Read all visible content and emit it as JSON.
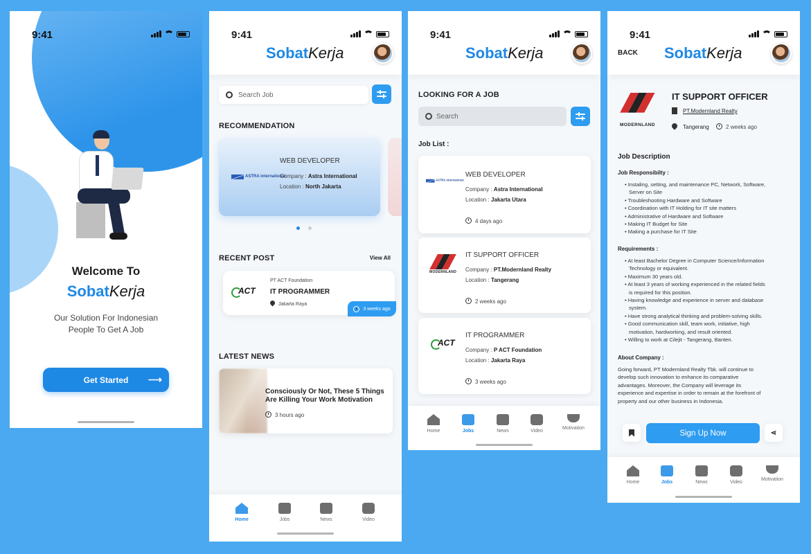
{
  "status": {
    "time": "9:41"
  },
  "brand": {
    "primary": "Sobat",
    "secondary": "Kerja"
  },
  "welcome": {
    "heading": "Welcome To",
    "tagline_line1": "Our Solution For Indonesian",
    "tagline_line2": "People To Get A Job",
    "cta": "Get Started",
    "arrow": "⟶"
  },
  "home": {
    "search_placeholder": "Search Job",
    "recommendation_title": "RECOMMENDATION",
    "rec_card": {
      "title": "WEB DEVELOPER",
      "company_label": "Company :",
      "company": "Astra International",
      "location_label": "Location :",
      "location": "North Jakarta",
      "logo_text": "ASTRA international"
    },
    "recent_post_title": "RECENT POST",
    "view_all": "View All",
    "recent_card": {
      "company": "PT ACT Foundation",
      "title": "IT PROGRAMMER",
      "location": "Jakarta Raya",
      "age": "3 weeks ago",
      "logo_text": "ACT"
    },
    "latest_news_title": "LATEST NEWS",
    "news": {
      "title_line1": "Consciously Or Not, These 5 Things",
      "title_line2": "Are Killing Your Work Motivation",
      "age": "3 hours ago"
    }
  },
  "jobs": {
    "heading": "LOOKING FOR A JOB",
    "search_placeholder": "Search",
    "list_title": "Job List :",
    "items": [
      {
        "title": "WEB DEVELOPER",
        "company_label": "Company :",
        "company": "Astra International",
        "location_label": "Location :",
        "location": "Jakarta Utara",
        "age": "4 days ago",
        "logo_text": "ASTRA international"
      },
      {
        "title": "IT SUPPORT OFFICER",
        "company_label": "Company :",
        "company": "PT.Modernland Realty",
        "location_label": "Location :",
        "location": "Tangerang",
        "age": "2 weeks ago",
        "logo_text": "MODERNLAND"
      },
      {
        "title": "IT PROGRAMMER",
        "company_label": "Company :",
        "company": "P ACT Foundation",
        "location_label": "Location :",
        "location": "Jakarta Raya",
        "age": "3 weeks ago",
        "logo_text": "ACT"
      }
    ]
  },
  "detail": {
    "back": "BACK",
    "title": "IT SUPPORT OFFICER",
    "company": "PT.Modernland Realty",
    "location": "Tangerang",
    "age": "2 weeks ago",
    "logo_text": "MODERNLAND",
    "desc_title": "Job Description",
    "resp_title": "Job Responsibilty :",
    "responsibilities": [
      "Instaling, setting, and maintenance PC, Network, Software,",
      "Server on Site",
      "Troubleshooting Hardware and Software",
      "Coordination with IT Holding for IT site matters",
      "Administrative of Hardware and Software",
      "Making IT Budget for Site",
      "Making a purchase for IT Site"
    ],
    "req_title": "Requirements :",
    "requirements": [
      "At least Bachelor Degree in Computer Science/Information",
      "Technology or equivalent.",
      "Maximum 30 years old.",
      "At least 3 years of working experienced in the related fields",
      "is required for this position.",
      "Having knowledge and experience in server and database",
      "system.",
      "Have strong analytical thinking and problem-solving skills.",
      "Good communication skill, team work, initiative, high",
      "motivation, hardworking, and result oriented.",
      "Willing to work at Cilejit - Tangerang, Banten."
    ],
    "about_title": "About Company :",
    "about_lines": [
      "Going forward, PT Modernland Realty Tbk. will continue to",
      "develop such innovation to enhance its comparative",
      "advantages. Moreover, the Company will leverage its",
      "experience and expertise in order to remain at the forefront of",
      "property and our other business in Indonesia."
    ],
    "cta": "Sign Up Now"
  },
  "tabs": {
    "home": "Home",
    "jobs": "Jobs",
    "news": "News",
    "video": "Video",
    "motivation": "Motivation"
  },
  "colors": {
    "accent": "#1e88e5",
    "background": "#4aa9f0"
  }
}
